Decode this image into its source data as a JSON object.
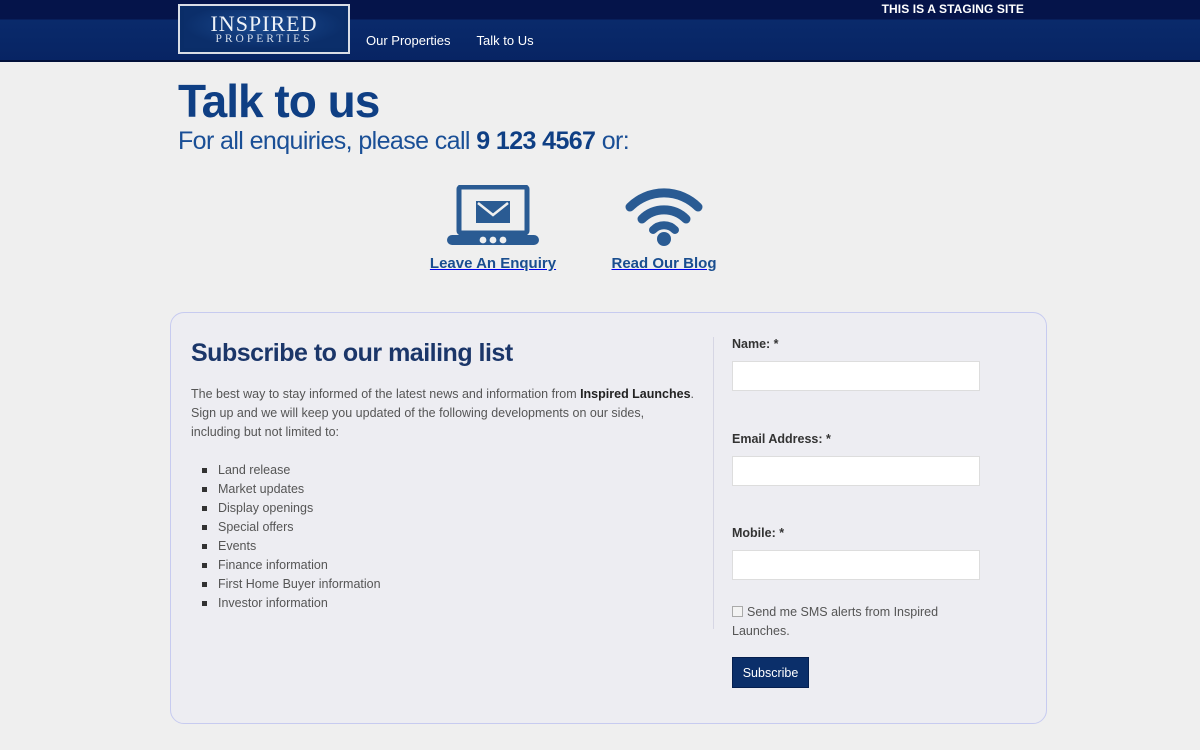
{
  "header": {
    "staging_notice": "THIS IS A STAGING SITE",
    "logo": {
      "main": "INSPIRED",
      "sub": "PROPERTIES"
    },
    "nav": [
      {
        "label": "Our Properties"
      },
      {
        "label": "Talk to Us"
      }
    ]
  },
  "page": {
    "title": "Talk to us",
    "subtitle_prefix": "For all enquiries, please call ",
    "phone": "9 123 4567",
    "subtitle_suffix": " or:"
  },
  "actions": [
    {
      "label": "Leave An Enquiry",
      "icon": "laptop-mail-icon"
    },
    {
      "label": "Read Our Blog",
      "icon": "rss-feed-icon"
    }
  ],
  "subscribe": {
    "title": "Subscribe to our mailing list",
    "intro_prefix": "The best way to stay informed of the latest news and information from ",
    "intro_brand": "Inspired Launches",
    "intro_suffix": ". Sign up and we will keep you updated of the following developments on our sides, including but not limited to:",
    "items": [
      "Land release",
      "Market updates",
      "Display openings",
      "Special offers",
      "Events",
      "Finance information",
      "First Home Buyer information",
      "Investor information"
    ],
    "form": {
      "name_label": "Name: *",
      "name_value": "",
      "email_label": "Email Address: *",
      "email_value": "",
      "mobile_label": "Mobile: *",
      "mobile_value": "",
      "sms_label": "Send me SMS alerts from Inspired Launches.",
      "sms_checked": false,
      "submit_label": "Subscribe"
    }
  },
  "colors": {
    "header_bg": "#072463",
    "accent": "#0f3f84",
    "icon": "#2a5b93",
    "button": "#0b2f6a"
  }
}
